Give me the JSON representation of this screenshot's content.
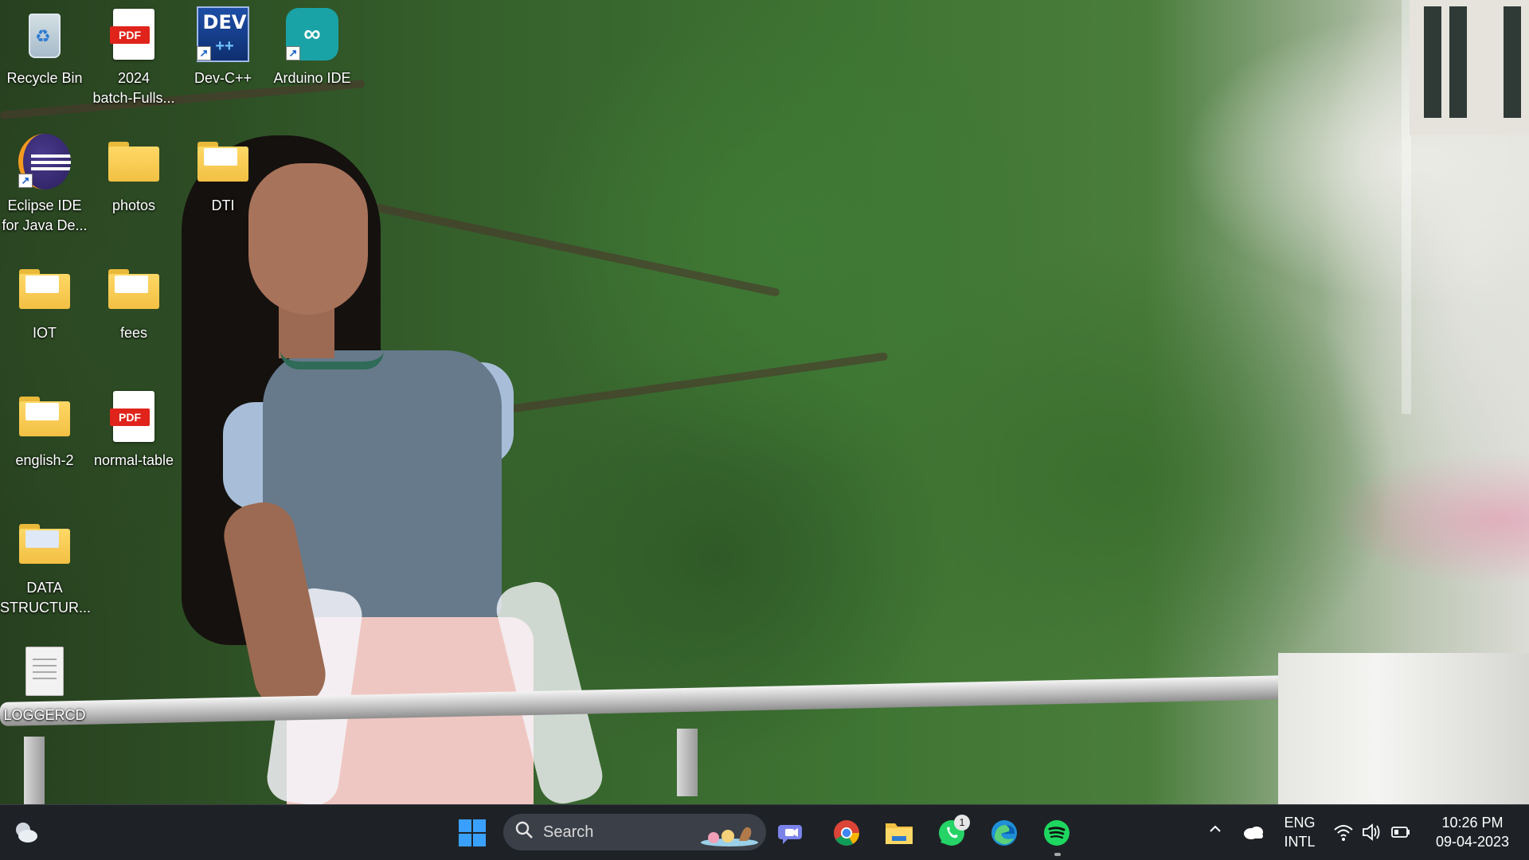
{
  "desktop": {
    "icons": [
      {
        "label": "Recycle Bin",
        "icon": "recycle-bin-icon"
      },
      {
        "label": "2024\nbatch-Fulls...",
        "icon": "pdf-file-icon"
      },
      {
        "label": "Dev-C++",
        "icon": "devcpp-icon"
      },
      {
        "label": "Arduino IDE",
        "icon": "arduino-icon"
      },
      {
        "label": "Eclipse IDE\nfor Java De...",
        "icon": "eclipse-icon"
      },
      {
        "label": "photos",
        "icon": "folder-icon"
      },
      {
        "label": "DTI",
        "icon": "folder-icon"
      },
      {
        "label": "IOT",
        "icon": "folder-icon"
      },
      {
        "label": "fees",
        "icon": "folder-icon"
      },
      {
        "label": "english-2",
        "icon": "folder-icon"
      },
      {
        "label": "normal-table",
        "icon": "pdf-file-icon"
      },
      {
        "label": "DATA\nSTRUCTUR...",
        "icon": "folder-icon"
      },
      {
        "label": "LOGGERCD",
        "icon": "text-file-icon"
      }
    ],
    "pdf_tag": "PDF",
    "dev_tag": "DEV",
    "dev_plus": "++"
  },
  "taskbar": {
    "search_label": "Search",
    "whatsapp_badge": "1",
    "language_line1": "ENG",
    "language_line2": "INTL",
    "time": "10:26 PM",
    "date": "09-04-2023",
    "colors": {
      "taskbar_bg": "#1e2026",
      "windows_blue": "#3aa0ff",
      "spotify_green": "#1ed760",
      "whatsapp_green": "#25d366"
    }
  }
}
